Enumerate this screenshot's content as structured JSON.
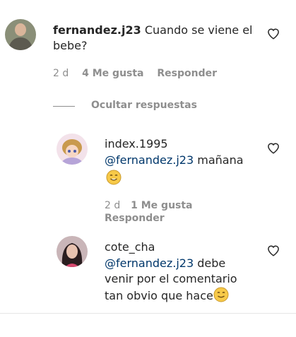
{
  "comment": {
    "username": "fernandez.j23",
    "text": "Cuando se viene el bebe?",
    "time": "2 d",
    "likes": "4 Me gusta",
    "reply": "Responder"
  },
  "toggle": {
    "label": "Ocultar respuestas"
  },
  "replies": [
    {
      "username": "index.1995",
      "mention": "@fernandez.j23",
      "text": "mañana",
      "time": "2 d",
      "likes": "1 Me gusta",
      "reply": "Responder"
    },
    {
      "username": "cote_cha",
      "mention": "@fernandez.j23",
      "text_line1": "debe",
      "text_line2": "venir por el comentario",
      "text_line3": "tan obvio que hace"
    }
  ],
  "icons": {
    "heart": "heart-outline-icon",
    "emoji": "smiling-face-emoji"
  },
  "colors": {
    "text": "#262626",
    "mention": "#00376b",
    "meta": "#8e8e8e",
    "emoji": "#f7c948"
  }
}
